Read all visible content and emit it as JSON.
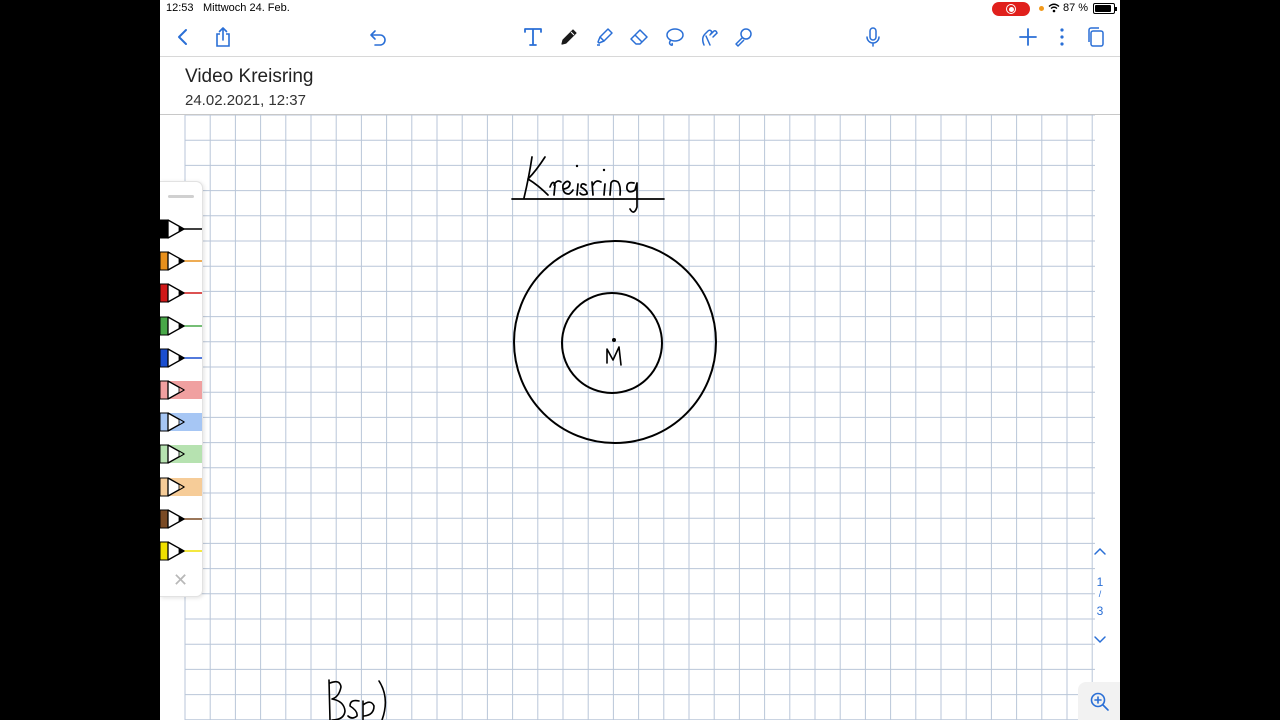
{
  "status_bar": {
    "time": "12:53",
    "date": "Mittwoch 24. Feb.",
    "battery_percent": "87 %",
    "battery_level": 0.87,
    "recording_color": "#e0201c"
  },
  "toolbar": {
    "icons": {
      "back": "chevron-left-icon",
      "share": "share-icon",
      "undo": "undo-icon",
      "text": "text-tool-icon",
      "pen": "pen-tool-icon",
      "highlighter": "highlighter-tool-icon",
      "eraser": "eraser-tool-icon",
      "lasso": "lasso-tool-icon",
      "shapes": "shapes-tool-icon",
      "laser": "laser-pointer-icon",
      "microphone": "microphone-icon",
      "add": "plus-icon",
      "more": "more-icon",
      "pages": "pages-icon"
    },
    "accent_color": "#2a6fd6"
  },
  "document": {
    "title": "Video Kreisring",
    "date": "24.02.2021, 12:37"
  },
  "canvas": {
    "handwriting": [
      "Kreisring",
      "M",
      "Bsp)"
    ],
    "drawing": "two concentric circles with centre point M"
  },
  "palette": {
    "pens": [
      {
        "name": "black-pen",
        "color": "#000000",
        "type": "pen"
      },
      {
        "name": "orange-pen",
        "color": "#e8901c",
        "type": "pen"
      },
      {
        "name": "red-pen",
        "color": "#d01818",
        "type": "pen"
      },
      {
        "name": "green-pen",
        "color": "#48a848",
        "type": "pen"
      },
      {
        "name": "blue-pen",
        "color": "#1a4ed0",
        "type": "pen"
      },
      {
        "name": "red-highlighter",
        "color": "#f0a0a0",
        "type": "highlighter"
      },
      {
        "name": "blue-highlighter",
        "color": "#a6c6f4",
        "type": "highlighter"
      },
      {
        "name": "green-highlighter",
        "color": "#b6e2b0",
        "type": "highlighter"
      },
      {
        "name": "orange-highlighter",
        "color": "#f6cc98",
        "type": "highlighter"
      },
      {
        "name": "brown-pen",
        "color": "#7a4a24",
        "type": "pen"
      },
      {
        "name": "yellow-pen",
        "color": "#f0e000",
        "type": "pen"
      }
    ],
    "close_icon": "close-icon"
  },
  "page_nav": {
    "current": "1",
    "separator": "/",
    "total": "3"
  },
  "zoom_icon": "zoom-in-icon"
}
